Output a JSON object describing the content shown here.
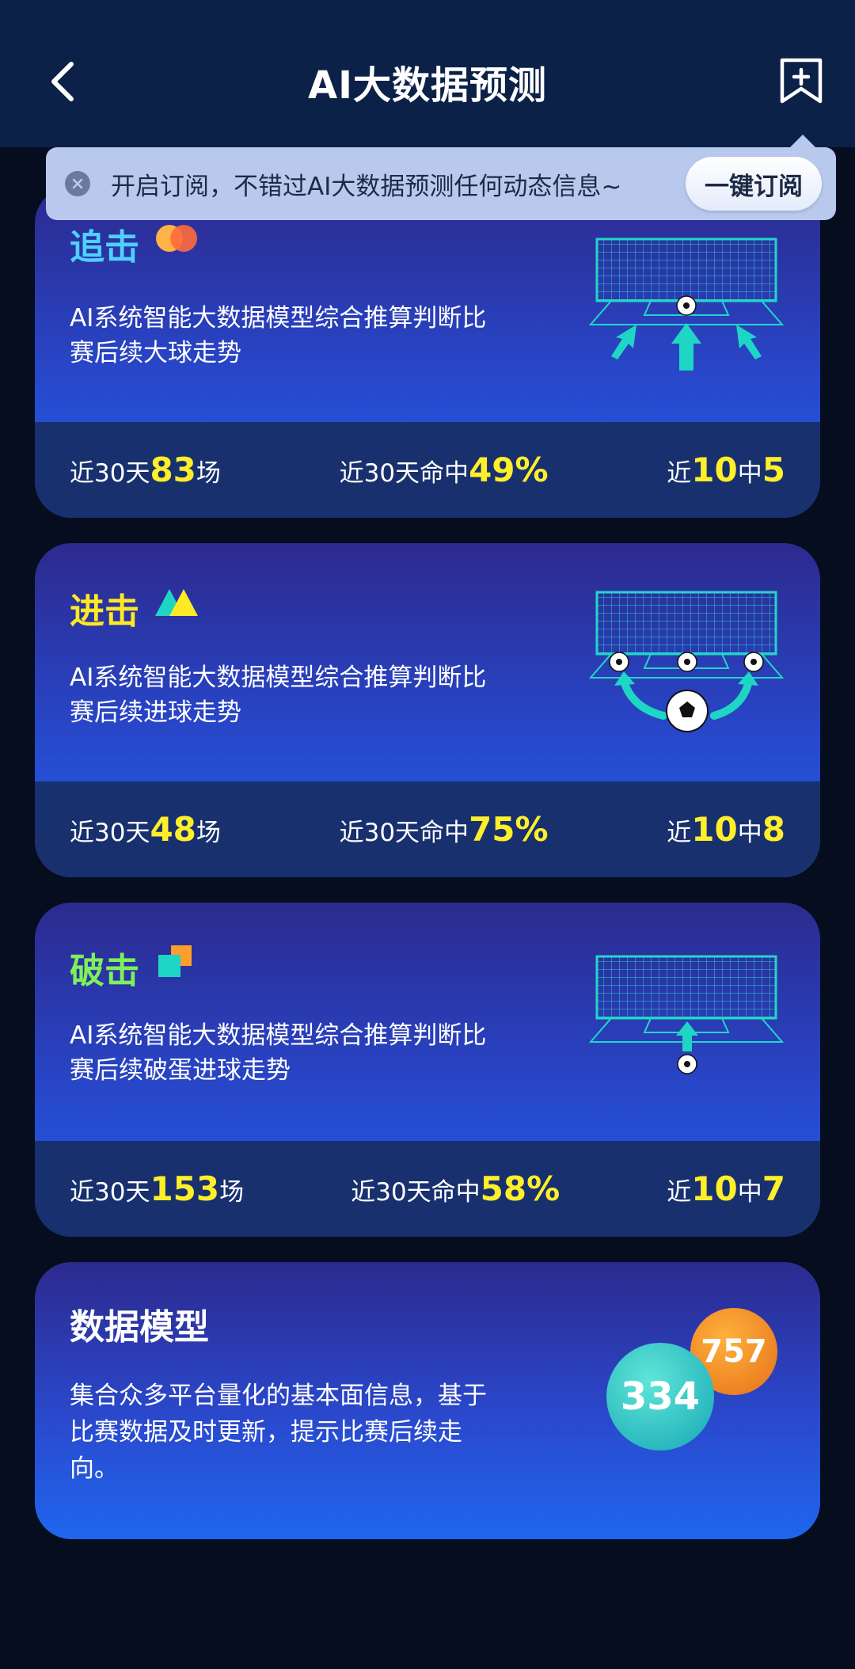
{
  "header": {
    "title": "AI大数据预测",
    "back_icon": "chevron-left-icon",
    "bookmark_icon": "bookmark-add-icon"
  },
  "subscribe": {
    "text": "开启订阅，不错过AI大数据预测任何动态信息~",
    "button_label": "一键订阅",
    "close_icon": "close-icon"
  },
  "cards": [
    {
      "title": "追击",
      "title_color": "#4fd0ff",
      "desc_line1": "AI系统智能大数据模型综合推算判断比",
      "desc_line2": "赛后续大球走势",
      "stats": {
        "days_prefix": "近30天",
        "matches": "83",
        "matches_suffix": "场",
        "hit_prefix": "近30天命中",
        "hit_rate": "49%",
        "recent_prefix": "近",
        "recent_total": "10",
        "recent_mid": "中",
        "recent_hits": "5"
      }
    },
    {
      "title": "进击",
      "title_color": "#ffe924",
      "desc_line1": "AI系统智能大数据模型综合推算判断比",
      "desc_line2": "赛后续进球走势",
      "stats": {
        "days_prefix": "近30天",
        "matches": "48",
        "matches_suffix": "场",
        "hit_prefix": "近30天命中",
        "hit_rate": "75%",
        "recent_prefix": "近",
        "recent_total": "10",
        "recent_mid": "中",
        "recent_hits": "8"
      }
    },
    {
      "title": "破击",
      "title_color": "#7ef05a",
      "desc_line1": "AI系统智能大数据模型综合推算判断比",
      "desc_line2": "赛后续破蛋进球走势",
      "stats": {
        "days_prefix": "近30天",
        "matches": "153",
        "matches_suffix": "场",
        "hit_prefix": "近30天命中",
        "hit_rate": "58%",
        "recent_prefix": "近",
        "recent_total": "10",
        "recent_mid": "中",
        "recent_hits": "7"
      }
    }
  ],
  "model": {
    "title": "数据模型",
    "desc_line1": "集合众多平台量化的基本面信息，基于",
    "desc_line2": "比赛数据及时更新，提示比赛后续走",
    "desc_line3": "向。",
    "bubble_teal": "334",
    "bubble_orange": "757"
  },
  "colors": {
    "header_bg": "#0b2148",
    "highlight": "#ffef2a",
    "accent_teal": "#1fd6c4"
  }
}
